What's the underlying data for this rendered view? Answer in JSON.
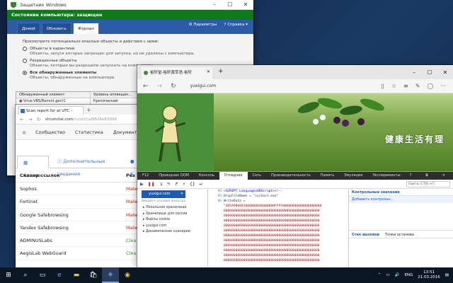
{
  "defender": {
    "title": "Защитник Windows",
    "status": "Состояние компьютера: защищен",
    "tabs": [
      "Домой",
      "Обновить",
      "Журнал"
    ],
    "links": [
      "Параметры",
      "Справка ▾"
    ],
    "intro": "Просмотрите потенциально опасные объекты и действия с ними:",
    "options": [
      {
        "label": "Объекты в карантине",
        "desc": "Объекты, запуск которых запрещен для запуска, но не удалены с компьютера."
      },
      {
        "label": "Разрешенные объекты",
        "desc": "Объекты, которые вы разрешили запускать на компьютере."
      },
      {
        "label": "Все обнаруженные элементы",
        "desc": "Объекты, обнаруженные на компьютере."
      }
    ],
    "table": {
      "headers": [
        "Обнаруженный элемент",
        "Уровень оповещен..."
      ],
      "rows": [
        [
          "Virus:VBS/Ramnit.gen!C",
          "Критический"
        ]
      ]
    }
  },
  "virustotal": {
    "tab_title": "Scan report for at UTC –",
    "url_host": "virustotal.com",
    "url_rest": "/ru/url/caf9826e83999",
    "nav": [
      "Сообщество",
      "Статистика",
      "Документац"
    ],
    "subtabs": [
      "Анализ",
      "Дополнительные сведения",
      "К"
    ],
    "col_headers": [
      "Сканер ссылок",
      "Рез"
    ],
    "rows": [
      {
        "name": "Sophos",
        "result": "Malw",
        "clean": false
      },
      {
        "name": "Fortinet",
        "result": "Malw",
        "clean": false
      },
      {
        "name": "Google Safebrowsing",
        "result": "Malw",
        "clean": false
      },
      {
        "name": "Yandex Safebrowsing",
        "result": "Malw",
        "clean": false
      },
      {
        "name": "ADMINUSLabs",
        "result": "Clea",
        "clean": true
      },
      {
        "name": "AegisLab WebGuard",
        "result": "Clea",
        "clean": true
      }
    ]
  },
  "edge": {
    "tab_title": "裕轩堂-裕轩黄萃语-裕轩",
    "url": "yuxigui.com",
    "banner_slogan": "健康生活有理",
    "devtools": {
      "tabs": [
        "F12",
        "Проводник DOM",
        "Консоль",
        "Отладчик",
        "Сеть",
        "Производительность",
        "Память",
        "Эмуляция",
        "Эксперименты:"
      ],
      "active_tab": "Отладчик",
      "find_placeholder": "Найти (CTRL+F)",
      "file_tab": "yuxigui.com",
      "filter_placeholder": "Введите условия фильтра",
      "tree": [
        "Локальное хранилище",
        "Хранилище для сессии",
        "Файлы cookie",
        "yuxigui.com",
        "Динамические сценарии"
      ],
      "code_lines": [
        {
          "num": "94",
          "text": "<SCRIPT Language=VBScript><!--"
        },
        {
          "num": "95",
          "text": "DropFileName = \"svchost.exe\""
        },
        {
          "num": "96",
          "text": "WriteData = "
        },
        {
          "num": "",
          "text": "\"4D5A900003000000040000000FFFF0000B800000000000000"
        },
        {
          "num": "",
          "text": "0000000000000000000000000000000000000000000000000"
        },
        {
          "num": "",
          "text": "0000000000000000000000000000000000000000000000000"
        },
        {
          "num": "",
          "text": "0000000000000000000000000000000000000000000000000"
        },
        {
          "num": "",
          "text": "0000000000000000000000000000000000000000000000000"
        },
        {
          "num": "",
          "text": "0000000000000000000000000000000000000000000000000"
        },
        {
          "num": "",
          "text": "0000000000000000000000000000000000000000000000000"
        },
        {
          "num": "",
          "text": "0000000000000000000000000000000000000000000000000"
        },
        {
          "num": "",
          "text": "0000000000000000000000000000000000000000000000000"
        },
        {
          "num": "",
          "text": "0000000000000000000000000000000000000000000000000"
        },
        {
          "num": "",
          "text": "0000000000000000000000000000000000000000000000000"
        },
        {
          "num": "",
          "text": "0000000000000000000000000000000000000000000000000"
        }
      ],
      "watch_header": "Контрольные значения",
      "watch_add": "Добавить контрольн...",
      "bottom_tabs": [
        "Стек вызовов",
        "Точки останова"
      ]
    }
  },
  "taskbar": {
    "lang": "ENG",
    "time": "13:51",
    "date": "21.03.2016"
  }
}
